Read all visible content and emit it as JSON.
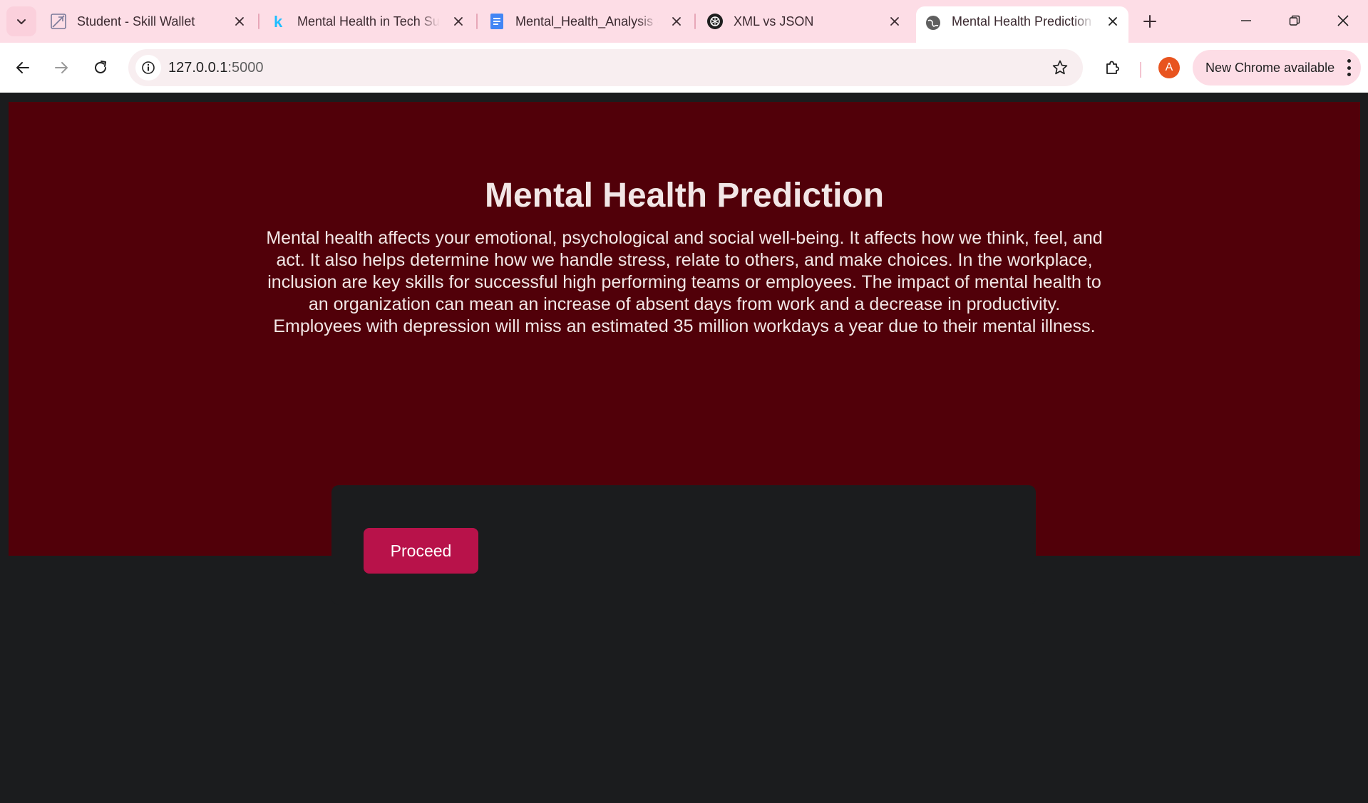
{
  "browser": {
    "tabs": [
      {
        "title": "Student - Skill Wallet",
        "icon": "skill-wallet-favicon",
        "active": false
      },
      {
        "title": "Mental Health in Tech Su",
        "icon": "kaggle-favicon",
        "active": false
      },
      {
        "title": "Mental_Health_Analysis -",
        "icon": "google-docs-favicon",
        "active": false
      },
      {
        "title": "XML vs JSON",
        "icon": "chatgpt-favicon",
        "active": false
      },
      {
        "title": "Mental Health Prediction",
        "icon": "globe-favicon",
        "active": true
      }
    ],
    "address": {
      "host": "127.0.0.1",
      "port": ":5000"
    },
    "update_label": "New Chrome available",
    "profile_initial": "A",
    "colors": {
      "tabstrip": "#fddde6",
      "avatar": "#e8541f"
    }
  },
  "page": {
    "title": "Mental Health Prediction",
    "description": "Mental health affects your emotional, psychological and social well-being. It affects how we think, feel, and act. It also helps determine how we handle stress, relate to others, and make choices. In the workplace, inclusion are key skills for successful high performing teams or employees. The impact of mental health to an organization can mean an increase of absent days from work and a decrease in productivity. Employees with depression will miss an estimated 35 million workdays a year due to their mental illness.",
    "proceed_label": "Proceed",
    "colors": {
      "hero_bg": "#510009",
      "panel_bg": "#1b1c1e",
      "button_bg": "#b8124a",
      "text": "#f2e6e6"
    }
  }
}
